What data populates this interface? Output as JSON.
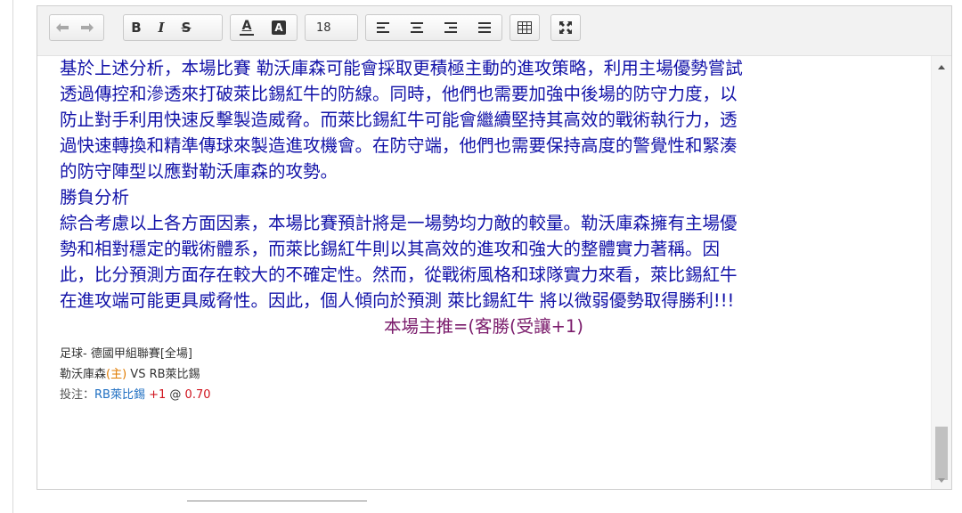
{
  "toolbar": {
    "font_size": "18",
    "icons": [
      "undo-icon",
      "redo-icon",
      "bold-icon",
      "italic-icon",
      "strikethrough-icon",
      "font-color-icon",
      "background-color-icon",
      "align-left-icon",
      "align-center-icon",
      "align-right-icon",
      "justify-icon",
      "table-icon",
      "fullscreen-icon"
    ],
    "bold_label": "B",
    "italic_label": "I",
    "strike_label": "S",
    "font_color_label": "A",
    "bg_color_label": "A"
  },
  "content": {
    "paragraph_lines": [
      "基於上述分析，本場比賽 勒沃庫森可能會採取更積極主動的進攻策略，利用主場優勢嘗試",
      "透過傳控和滲透來打破萊比錫紅牛的防線。同時，他們也需要加強中後場的防守力度，以",
      "防止對手利用快速反擊製造威脅。而萊比錫紅牛可能會繼續堅持其高效的戰術執行力，透",
      "過快速轉換和精準傳球來製造進攻機會。在防守端，他們也需要保持高度的警覺性和緊湊",
      "的防守陣型以應對勒沃庫森的攻勢。"
    ],
    "section_heading": "勝負分析",
    "conclusion_lines": [
      "綜合考慮以上各方面因素，本場比賽預計將是一場勢均力敵的較量。勒沃庫森擁有主場優",
      "勢和相對穩定的戰術體系，而萊比錫紅牛則以其高效的進攻和強大的整體實力著稱。因",
      "此，比分預測方面存在較大的不確定性。然而，從戰術風格和球隊實力來看，萊比錫紅牛",
      "在進攻端可能更具威脅性。因此，個人傾向於預測 萊比錫紅牛 將以微弱優勢取得勝利!!!"
    ],
    "main_pick": "本場主推=(客勝(受讓+1)",
    "league": "足球- 德國甲組聯賽[全場]",
    "home_team": "勒沃庫森",
    "home_tag": "(主)",
    "vs": " VS ",
    "away_team": "RB萊比錫",
    "bet_label": "投注：",
    "bet_team": "RB萊比錫",
    "bet_handicap": "+1",
    "bet_at": " @ ",
    "bet_odds": "0.70"
  },
  "colors": {
    "body_text": "#1212a8",
    "pick_text": "#7a1b6b",
    "home_tag": "#e07b00",
    "bet_team": "#1f6fc2",
    "odds": "#d0141e"
  }
}
